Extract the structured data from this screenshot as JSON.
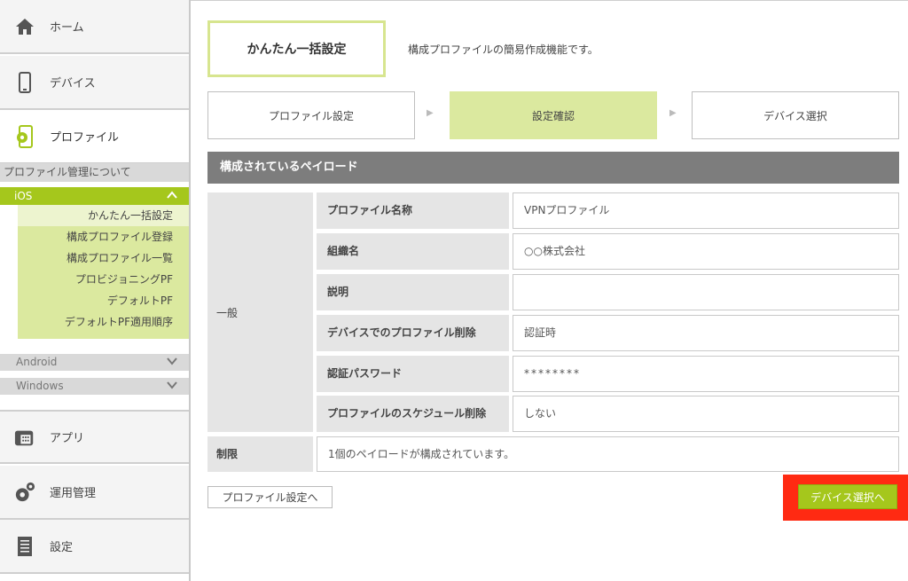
{
  "sidebar": {
    "home": "ホーム",
    "device": "デバイス",
    "profile": "プロファイル",
    "about": "プロファイル管理について",
    "ios": {
      "label": "iOS",
      "items": [
        "かんたん一括設定",
        "構成プロファイル登録",
        "構成プロファイル一覧",
        "プロビジョニングPF",
        "デフォルトPF",
        "デフォルトPF適用順序"
      ]
    },
    "android": "Android",
    "windows": "Windows",
    "app": "アプリ",
    "ops": "運用管理",
    "settings": "設定"
  },
  "header": {
    "title": "かんたん一括設定",
    "description": "構成プロファイルの簡易作成機能です。"
  },
  "steps": [
    "プロファイル設定",
    "設定確認",
    "デバイス選択"
  ],
  "section_title": "構成されているペイロード",
  "general_label": "一般",
  "rows": [
    {
      "label": "プロファイル名称",
      "value": "VPNプロファイル"
    },
    {
      "label": "組織名",
      "value": "○○株式会社"
    },
    {
      "label": "説明",
      "value": ""
    },
    {
      "label": "デバイスでのプロファイル削除",
      "value": "認証時"
    },
    {
      "label": "認証パスワード",
      "value": "********"
    },
    {
      "label": "プロファイルのスケジュール削除",
      "value": "しない"
    }
  ],
  "limit": {
    "label": "制限",
    "value": "1個のペイロードが構成されています。"
  },
  "buttons": {
    "back": "プロファイル設定へ",
    "next": "デバイス選択へ"
  },
  "colors": {
    "accent": "#a5c71c",
    "highlight": "#ff2a12"
  }
}
